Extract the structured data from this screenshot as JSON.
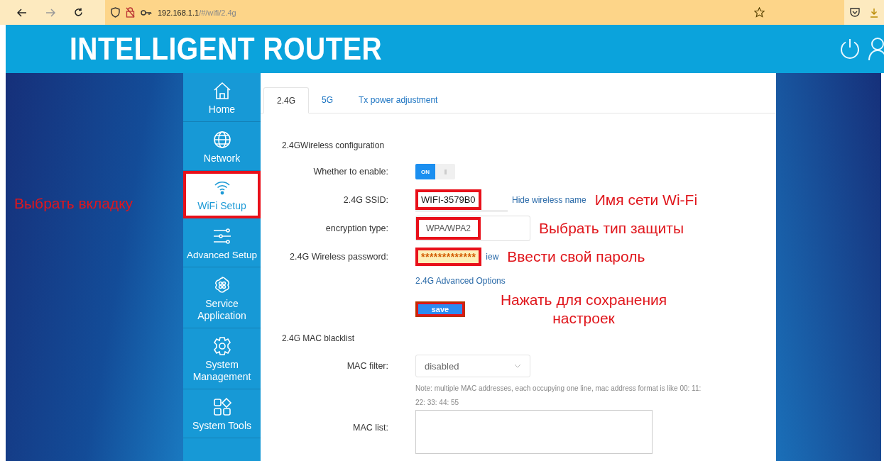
{
  "browser": {
    "url_host": "192.168.1.1",
    "url_path": "/#/wifi/2.4g"
  },
  "header": {
    "title": "INTELLIGENT ROUTER"
  },
  "left_annotation": "Выбрать вкладку",
  "sidebar": {
    "items": [
      {
        "label": "Home",
        "selected": false,
        "highlighted": false
      },
      {
        "label": "Network",
        "selected": false,
        "highlighted": false
      },
      {
        "label": "WiFi Setup",
        "selected": true,
        "highlighted": true
      },
      {
        "label": "Advanced Setup",
        "selected": false,
        "highlighted": false
      },
      {
        "label": "Service Application",
        "selected": false,
        "highlighted": false
      },
      {
        "label": "System Management",
        "selected": false,
        "highlighted": false
      },
      {
        "label": "System Tools",
        "selected": false,
        "highlighted": false
      }
    ]
  },
  "tabs": [
    {
      "label": "2.4G",
      "selected": true
    },
    {
      "label": "5G",
      "selected": false
    },
    {
      "label": "Tx power adjustment",
      "selected": false
    }
  ],
  "wireless": {
    "title": "2.4GWireless configuration",
    "rows": [
      {
        "kind": "toggle",
        "label": "Whether to enable:",
        "on": true,
        "on_label": "ON"
      },
      {
        "kind": "text",
        "label": "2.4G SSID:",
        "value": "WIFI-3579B0",
        "link": "Hide wireless name",
        "highlighted": true,
        "annotation": "Имя сети Wi-Fi"
      },
      {
        "kind": "select",
        "label": "encryption type:",
        "value": "WPA/WPA2",
        "highlighted": true,
        "annotation": "Выбрать тип защиты"
      },
      {
        "kind": "password",
        "label": "2.4G Wireless password:",
        "value": "*************",
        "link": "iew",
        "highlighted": true,
        "annotation": "Ввести свой пароль"
      }
    ],
    "advanced_link": "2.4G Advanced Options",
    "save": {
      "label": "save",
      "highlighted": true,
      "annotation": "Нажать для сохранения настроек"
    }
  },
  "mac": {
    "title": "2.4G MAC blacklist",
    "filter_label": "MAC filter:",
    "filter_value": "disabled",
    "note": "Note: multiple MAC addresses, each occupying one line, mac address format is like 00: 11: 22: 33: 44: 55",
    "list_label": "MAC list:"
  }
}
